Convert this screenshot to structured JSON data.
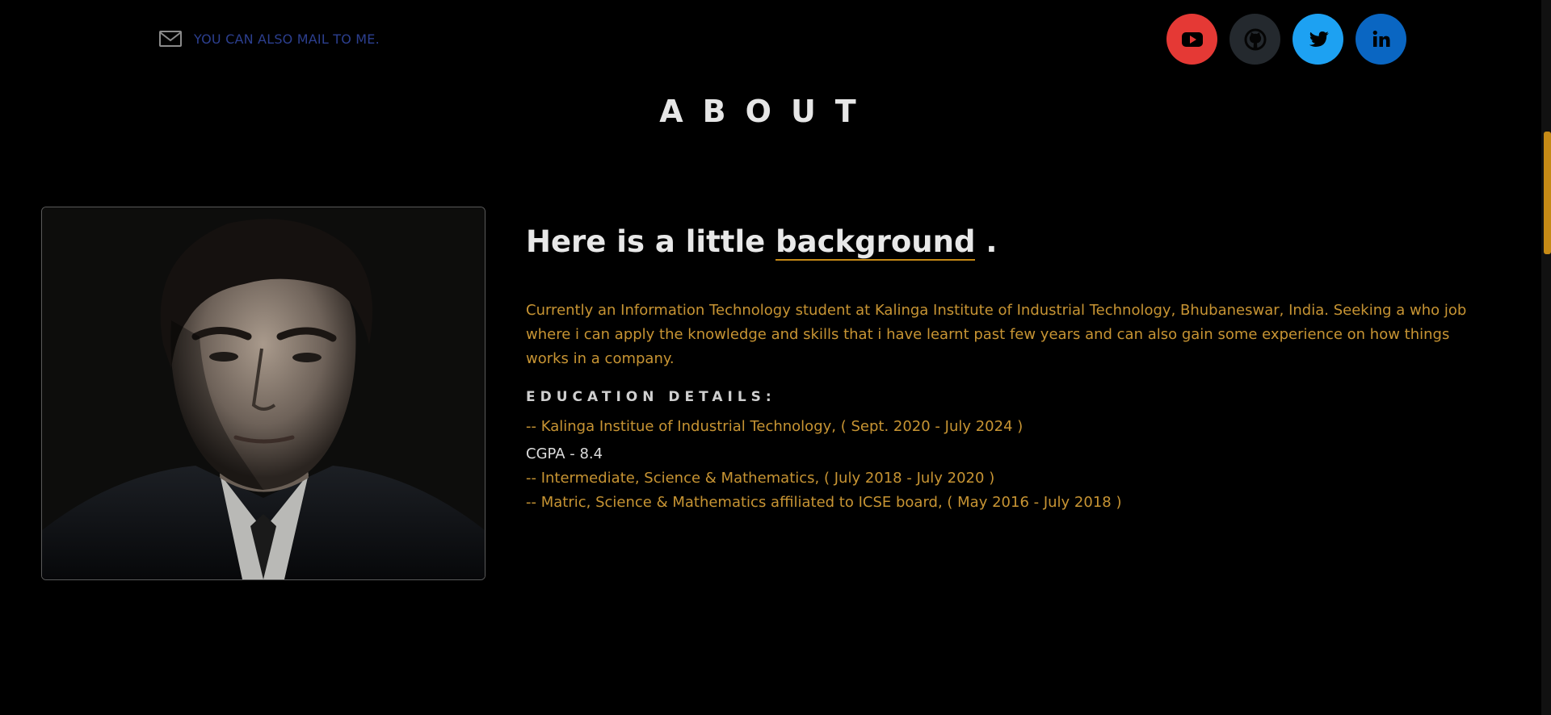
{
  "header": {
    "mail_text": "YOU CAN ALSO MAIL TO ME.",
    "mail_icon": "envelope-icon",
    "socials": [
      {
        "name": "youtube",
        "icon": "youtube-icon",
        "color": "#e53935"
      },
      {
        "name": "github",
        "icon": "github-icon",
        "color": "#24292e"
      },
      {
        "name": "twitter",
        "icon": "twitter-icon",
        "color": "#1da1f2"
      },
      {
        "name": "linkedin",
        "icon": "linkedin-icon",
        "color": "#0a66c2"
      }
    ]
  },
  "about": {
    "title": "ABOUT",
    "heading_prefix": "Here is a little ",
    "heading_accent": "background",
    "heading_suffix": " .",
    "intro": "Currently an Information Technology student at Kalinga Institute of Industrial Technology, Bhubaneswar, India. Seeking a who job where i can apply the knowledge and skills that i have learnt past few years and can also gain some experience on how things works in a company.",
    "education_title": "EDUCATION DETAILS:",
    "education": [
      "-- Kalinga Institue of Industrial Technology, ( Sept. 2020 - July 2024 )",
      "-- Intermediate, Science & Mathematics, ( July 2018 - July 2020 )",
      "-- Matric, Science & Mathematics affiliated to ICSE board, ( May 2016 - July 2018 )"
    ],
    "cgpa": "CGPA - 8.4"
  },
  "theme": {
    "background": "#000000",
    "accent": "#c68a16",
    "text_gold": "#c79433"
  }
}
